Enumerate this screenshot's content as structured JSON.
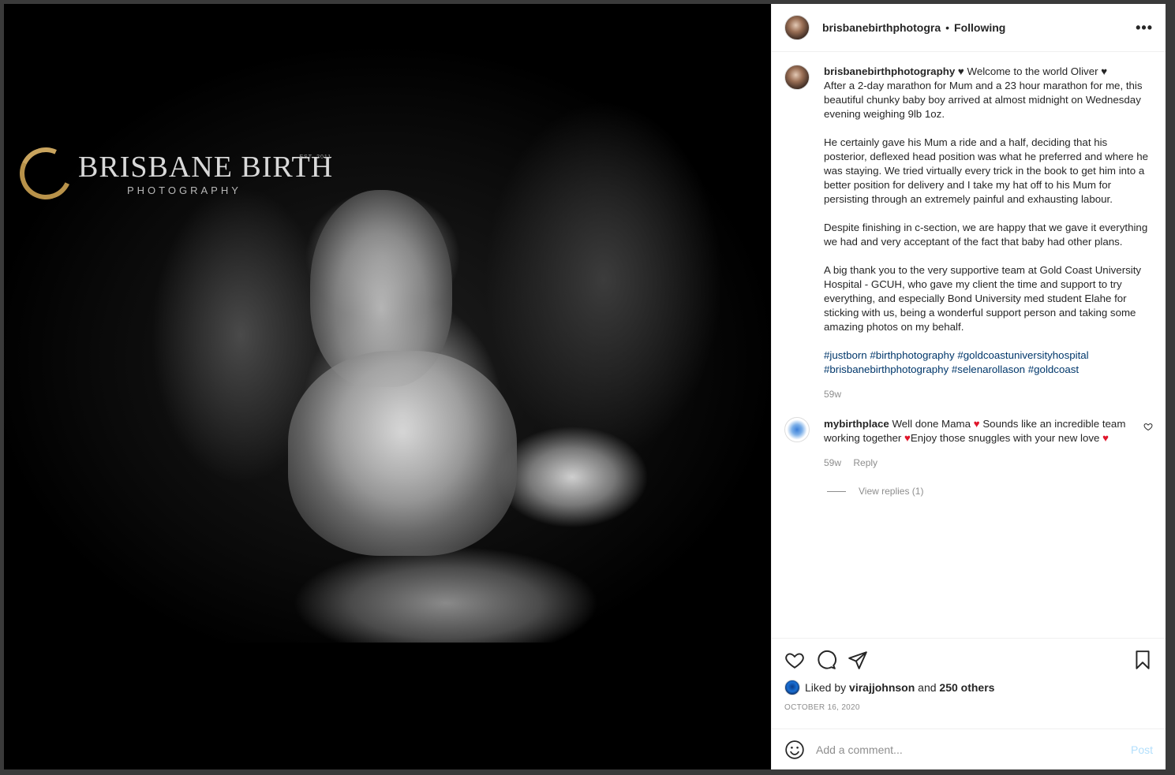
{
  "photo": {
    "logo_brand": "BRISBANE BIRTH",
    "logo_sub": "PHOTOGRAPHY",
    "logo_est": "EST. 2011"
  },
  "header": {
    "username": "brisbanebirthphotogra",
    "separator": "•",
    "follow_label": "Following",
    "more_icon": "more-horizontal-icon"
  },
  "caption": {
    "username": "brisbanebirthphotography",
    "paragraphs": [
      "♥ Welcome to the world Oliver ♥\nAfter a 2-day marathon for Mum and a 23 hour marathon for me, this beautiful chunky baby boy arrived at almost midnight on Wednesday evening weighing 9lb 1oz.",
      "He certainly gave his Mum a ride and a half, deciding that his posterior, deflexed head position was what he preferred and where he was staying. We tried virtually every trick in the book to get him into a better position for delivery and I take my hat off to his Mum for persisting through an extremely painful and exhausting labour.",
      "Despite finishing in c-section, we are happy that we gave it everything we had and very acceptant of the fact that baby had other plans.",
      "A big thank you to the very supportive team at Gold Coast University Hospital - GCUH, who gave my client the time and support to try everything, and especially Bond University med student Elahe for sticking with us, being a wonderful support person and taking some amazing photos on my behalf."
    ],
    "hashtags": [
      "#justborn",
      "#birthphotography",
      "#goldcoastuniversityhospital",
      "#brisbanebirthphotography",
      "#selenarollason",
      "#goldcoast"
    ],
    "time": "59w"
  },
  "comment": {
    "username": "mybirthplace",
    "text_1": "Well done Mama",
    "text_2": "Sounds like an incredible team working together",
    "text_3": "Enjoy those snuggles with your new love",
    "heart": "♥",
    "time": "59w",
    "reply_label": "Reply",
    "view_replies": "View replies (1)"
  },
  "actions": {
    "liked_by_prefix": "Liked by",
    "liked_by_user": "virajjohnson",
    "and_label": "and",
    "others": "250 others",
    "date": "OCTOBER 16, 2020"
  },
  "add_comment": {
    "placeholder": "Add a comment...",
    "post_label": "Post"
  },
  "colors": {
    "link": "#00376b",
    "heart": "#e0162b",
    "post_disabled": "#b2dffc",
    "muted": "#8e8e8e"
  }
}
